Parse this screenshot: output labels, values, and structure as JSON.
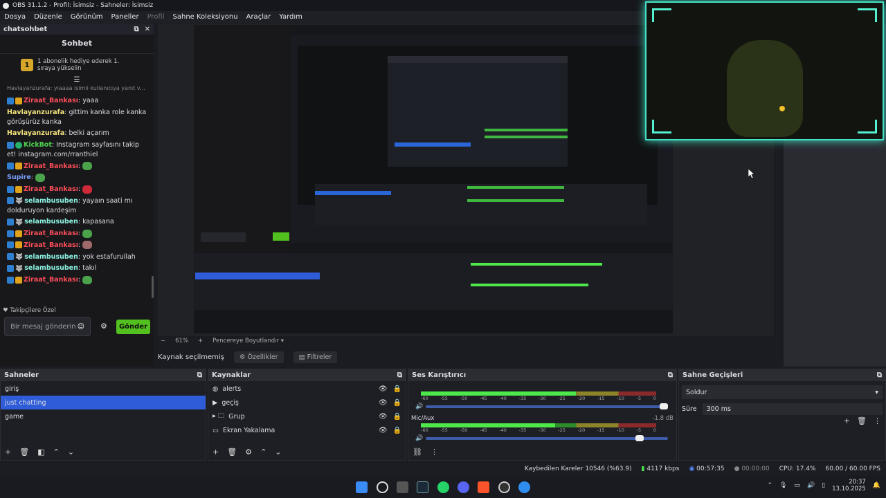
{
  "window": {
    "title": "OBS 31.1.2 - Profil: İsimsiz - Sahneler: İsimsiz"
  },
  "menu": [
    "Dosya",
    "Düzenle",
    "Görünüm",
    "Paneller",
    "Profil",
    "Sahne Koleksiyonu",
    "Araçlar",
    "Yardım"
  ],
  "chat": {
    "dock_title": "chatsohbet",
    "title": "Sohbet",
    "gift_text": "1 abonelik hediye ederek 1. sıraya yükselin",
    "gift_rank": "1",
    "reply_preview": "Havlayanzurafa: yiaaaa isimli kullanıcıya yanıt v...",
    "messages": [
      {
        "user": "Ziraat_Bankası",
        "color": "red",
        "badges": [
          "blue",
          "gold"
        ],
        "text": ": yaaa"
      },
      {
        "user": "Havlayanzurafa",
        "color": "yellow",
        "badges": [],
        "text": ": gitti​m kanka role kanka görüşürüz kanka"
      },
      {
        "user": "Havlayanzurafa",
        "color": "yellow",
        "badges": [],
        "text": ": belki açarım"
      },
      {
        "user": "KickBot",
        "color": "green",
        "badges": [
          "blue",
          "green"
        ],
        "text": ": Instagram sayfasını takip et! instagram.com/rranthiel"
      },
      {
        "user": "Ziraat_Bankası",
        "color": "red",
        "badges": [
          "blue",
          "gold"
        ],
        "text": ":",
        "emote": "pepe"
      },
      {
        "user": "Supire",
        "color": "blue",
        "badges": [],
        "text": ":",
        "emote": "pepe"
      },
      {
        "user": "Ziraat_Bankası",
        "color": "red",
        "badges": [
          "blue",
          "gold"
        ],
        "text": ":",
        "emote": "red"
      },
      {
        "user": "selambusuben",
        "color": "cyan",
        "badges": [
          "blue",
          "wolf"
        ],
        "text": ": yayaın saati mı dolduruyon kardeşim"
      },
      {
        "user": "selambusuben",
        "color": "cyan",
        "badges": [
          "blue",
          "wolf"
        ],
        "text": ": kapasana"
      },
      {
        "user": "Ziraat_Bankası",
        "color": "red",
        "badges": [
          "blue",
          "gold"
        ],
        "text": ":",
        "emote": "pepe"
      },
      {
        "user": "Ziraat_Bankası",
        "color": "red",
        "badges": [
          "blue",
          "gold"
        ],
        "text": ":",
        "emote": "pink"
      },
      {
        "user": "selambusuben",
        "color": "cyan",
        "badges": [
          "blue",
          "wolf"
        ],
        "text": ": yok estafurullah"
      },
      {
        "user": "selambusuben",
        "color": "cyan",
        "badges": [
          "blue",
          "wolf"
        ],
        "text": ": takıl"
      },
      {
        "user": "Ziraat_Bankası",
        "color": "red",
        "badges": [
          "blue",
          "gold"
        ],
        "text": ":",
        "emote": "pepe"
      }
    ],
    "follower_only": "Takipçilere Özel",
    "input_placeholder": "Bir mesaj gönderin",
    "send_label": "Gönder"
  },
  "preview": {
    "zoom": "61%",
    "fit_label": "Pencereye Boyutlandır",
    "no_source": "Kaynak seçilmemiş",
    "properties_label": "Özellikler",
    "filters_label": "Filtreler"
  },
  "scenes": {
    "title": "Sahneler",
    "items": [
      {
        "label": "giriş",
        "selected": false
      },
      {
        "label": "just chatting",
        "selected": true
      },
      {
        "label": "game",
        "selected": false
      }
    ]
  },
  "sources": {
    "title": "Kaynaklar",
    "items": [
      {
        "label": "alerts",
        "icon": "globe-icon"
      },
      {
        "label": "geçiş",
        "icon": "play-icon"
      },
      {
        "label": "Grup",
        "icon": "folder-icon"
      },
      {
        "label": "Ekran Yakalama",
        "icon": "monitor-icon"
      }
    ]
  },
  "mixer": {
    "title": "Ses Karıştırıcı",
    "scale": [
      "-60",
      "-55",
      "-50",
      "-45",
      "-40",
      "-35",
      "-30",
      "-25",
      "-20",
      "-15",
      "-10",
      "-5",
      "0"
    ],
    "channels": [
      {
        "name": "",
        "db": "",
        "level": 0.66,
        "volume": 1.0
      },
      {
        "name": "Mic/Aux",
        "db": "-1.8 dB",
        "level": 0.57,
        "volume": 0.9
      }
    ]
  },
  "transitions": {
    "title": "Sahne Geçişleri",
    "selected": "Soldur",
    "duration_label": "Süre",
    "duration_value": "300 ms"
  },
  "status": {
    "dropped": "Kaybedilen Kareler 10546 (%63.9)",
    "bitrate": "4117 kbps",
    "stream_time": "00:57:35",
    "rec_time": "00:00:00",
    "cpu": "CPU: 17.4%",
    "fps": "60.00 / 60.00 FPS"
  },
  "clock": {
    "time": "20:37",
    "date": "13.10.2025"
  },
  "colors": {
    "accent": "#2f5cd8",
    "send_green": "#52c11f",
    "webcam_border": "#46e0c6"
  }
}
